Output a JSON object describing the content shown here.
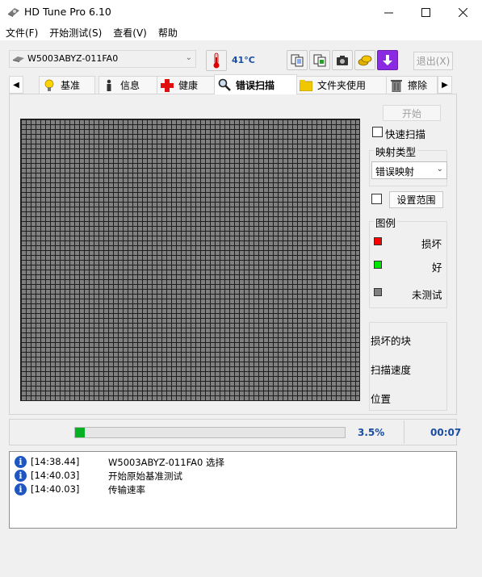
{
  "window": {
    "title": "HD Tune Pro 6.10"
  },
  "menu": [
    "文件(F)",
    "开始测试(S)",
    "查看(V)",
    "帮助"
  ],
  "toolbar": {
    "drive": "W5003ABYZ-011FA0",
    "temperature": "41°C",
    "exit_label": "退出(X)"
  },
  "tabs": [
    {
      "label": "基准",
      "icon": "bulb-icon"
    },
    {
      "label": "信息",
      "icon": "info-icon"
    },
    {
      "label": "健康",
      "icon": "health-cross-icon"
    },
    {
      "label": "错误扫描",
      "icon": "magnifier-icon",
      "active": true
    },
    {
      "label": "文件夹使用",
      "icon": "folder-icon"
    },
    {
      "label": "擦除",
      "icon": "trash-icon"
    }
  ],
  "scan": {
    "start_label": "开始",
    "quick_scan_label": "快速扫描",
    "map_type_title": "映射类型",
    "map_type_value": "错误映射",
    "set_range_label": "设置范围",
    "legend_title": "图例",
    "legend": [
      {
        "label": "损坏",
        "color": "#ff0000"
      },
      {
        "label": "好",
        "color": "#00e600"
      },
      {
        "label": "未测试",
        "color": "#808080"
      }
    ],
    "stats": [
      "损坏的块",
      "扫描速度",
      "位置"
    ]
  },
  "progress": {
    "fraction": 0.035,
    "percent_label": "3.5%",
    "time": "00:07"
  },
  "log": [
    {
      "time": "[14:38.44]",
      "message": "W5003ABYZ-011FA0 选择"
    },
    {
      "time": "[14:40.03]",
      "message": "开始原始基准测试"
    },
    {
      "time": "[14:40.03]",
      "message": "传输速率"
    }
  ]
}
